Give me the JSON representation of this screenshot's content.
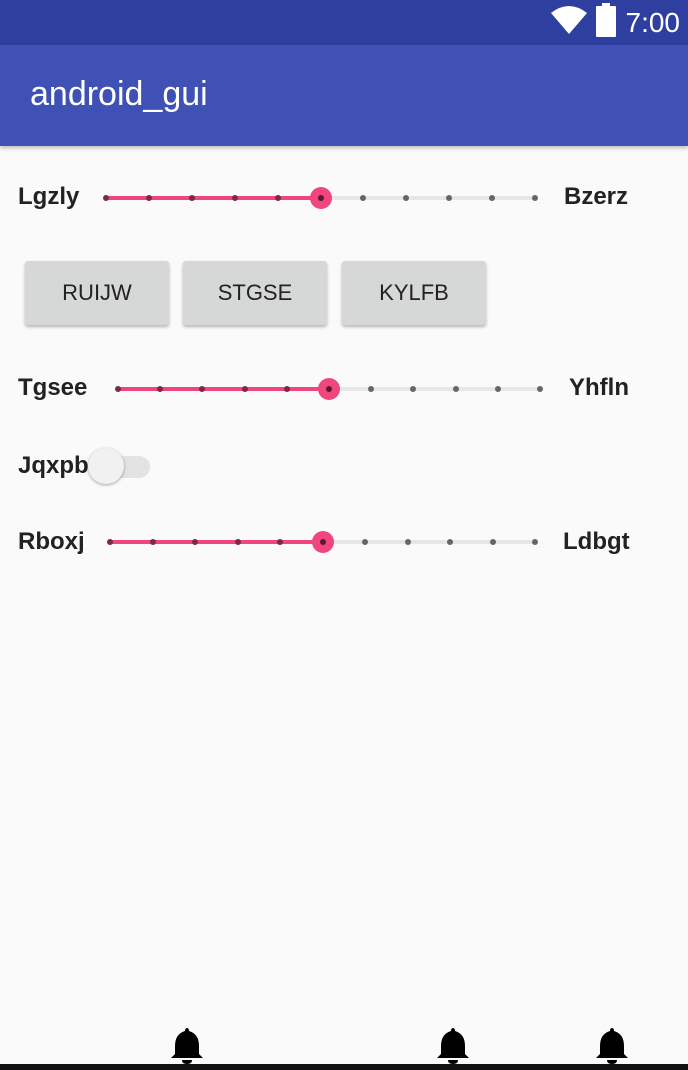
{
  "status_bar": {
    "time": "7:00",
    "icons": [
      "wifi-icon",
      "battery-icon"
    ]
  },
  "app_bar": {
    "title": "android_gui"
  },
  "rows": {
    "slider1": {
      "left_label": "Lgzly",
      "right_label": "Bzerz",
      "value": 5,
      "max": 10
    },
    "buttons": [
      "RUIJW",
      "STGSE",
      "KYLFB"
    ],
    "slider2": {
      "left_label": "Tgsee",
      "right_label": "Yhfln",
      "value": 5,
      "max": 10
    },
    "switch": {
      "label": "Jqxpb",
      "checked": false
    },
    "slider3": {
      "left_label": "Rboxj",
      "right_label": "Ldbgt",
      "value": 5,
      "max": 10
    }
  },
  "bottom": {
    "icons": [
      "bell-icon",
      "bell-icon",
      "bell-icon"
    ]
  },
  "colors": {
    "status_bar": "#2e3f9f",
    "app_bar": "#3f51b5",
    "accent": "#f0457d",
    "background": "#fafafa"
  }
}
